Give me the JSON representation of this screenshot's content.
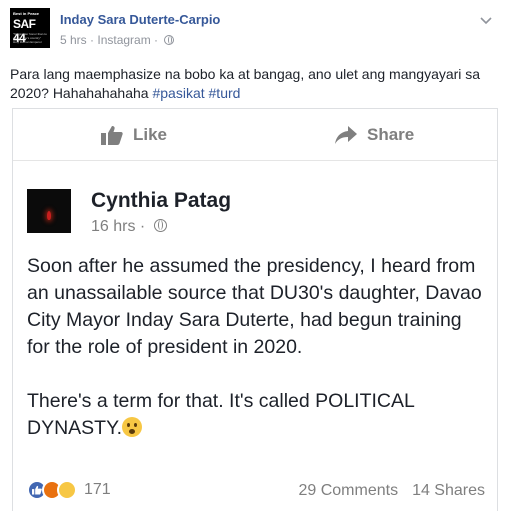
{
  "post": {
    "page_name": "Inday Sara Duterte-Carpio",
    "time": "5 hrs",
    "source": "Instagram",
    "text_main": "Para lang maemphasize na bobo ka at bangag, ano ulet ang mangyayari sa 2020? Hahahahahaha ",
    "hashtags": [
      "#pasikat",
      "#turd"
    ],
    "avatar_lines": [
      "Best in Peace",
      "SAF 44",
      "\"No greater honor than to die for one's country\" Holy Roman Emperor"
    ]
  },
  "shared_card": {
    "actions": {
      "like": "Like",
      "share": "Share"
    },
    "author": "Cynthia Patag",
    "time": "16 hrs",
    "paragraph_1": "Soon after he assumed the presidency, I heard from an unassailable source that DU30's daughter, Davao City Mayor Inday Sara Duterte, had begun training for the role of president in 2020.",
    "paragraph_2": "There's a term for that.  It's called POLITICAL DYNASTY.",
    "reaction_count": "171",
    "comments": "29 Comments",
    "shares": "14 Shares"
  },
  "colors": {
    "link": "#365899",
    "muted": "#90949c",
    "like_blue": "#4267b2"
  }
}
